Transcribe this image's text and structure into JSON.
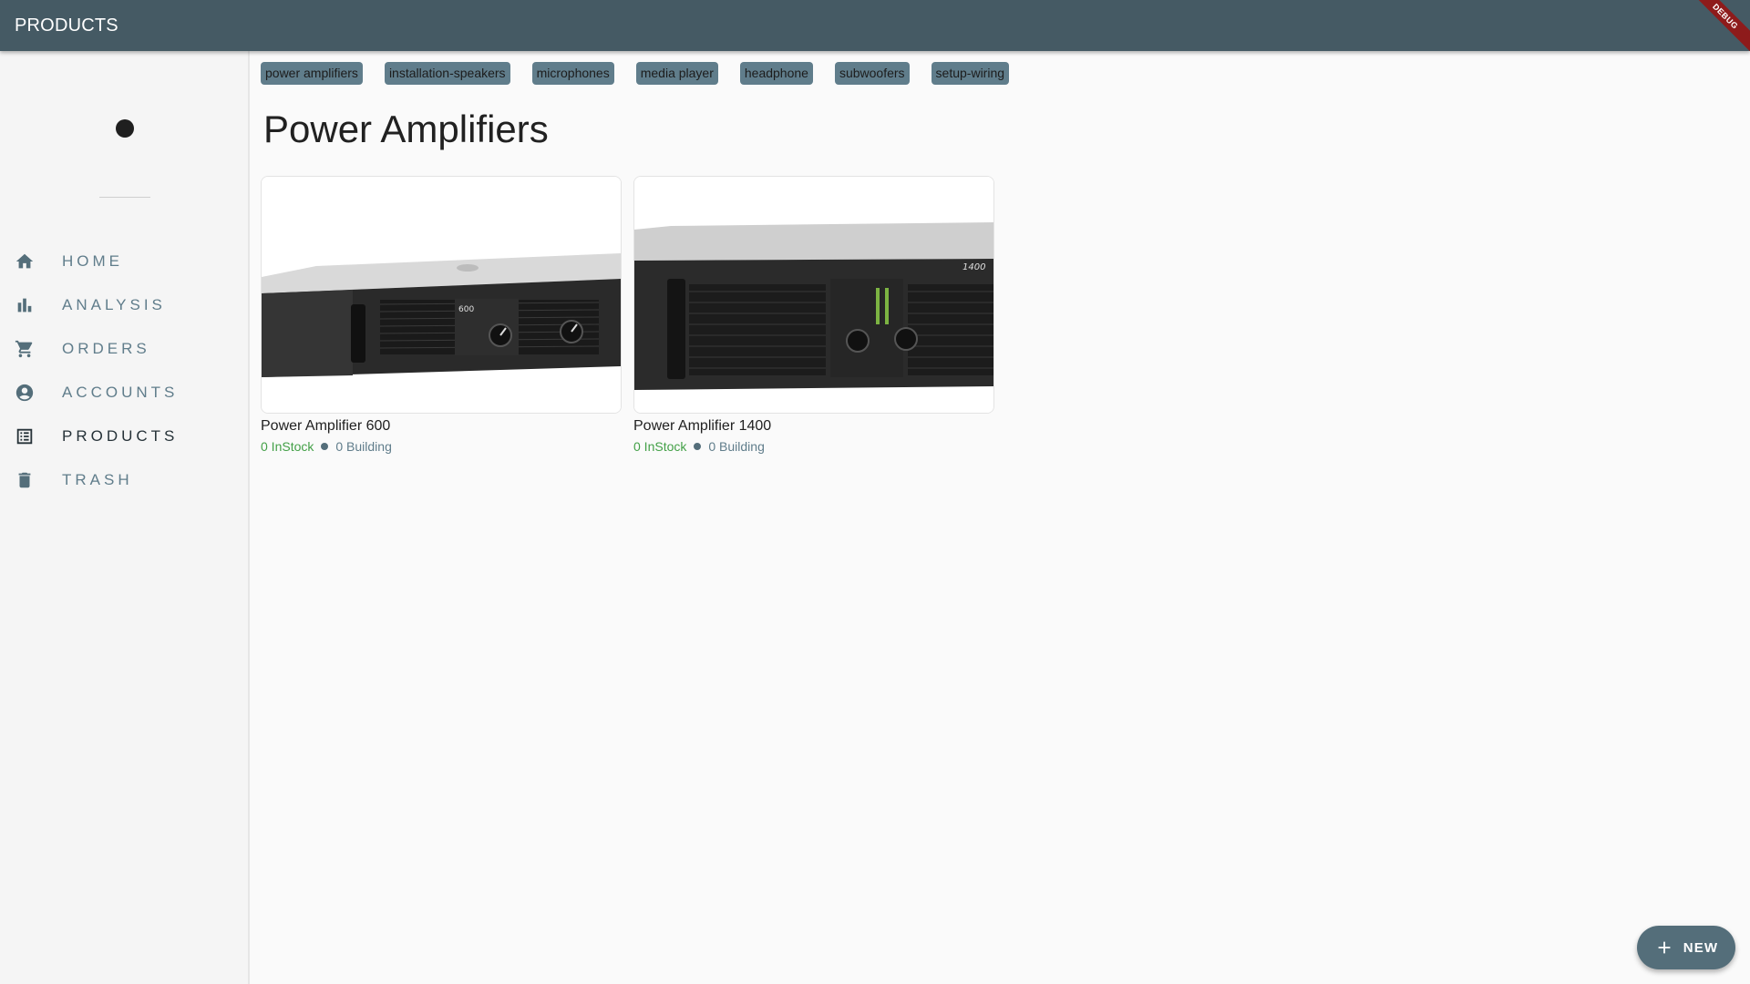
{
  "appbar": {
    "title": "PRODUCTS",
    "debug_banner": "DEBUG"
  },
  "sidebar": {
    "items": [
      {
        "label": "HOME",
        "icon": "home-icon"
      },
      {
        "label": "ANALYSIS",
        "icon": "bar-chart-icon"
      },
      {
        "label": "ORDERS",
        "icon": "cart-icon"
      },
      {
        "label": "ACCOUNTS",
        "icon": "account-circle-icon"
      },
      {
        "label": "PRODUCTS",
        "icon": "list-icon",
        "active": true
      },
      {
        "label": "TRASH",
        "icon": "trash-icon"
      }
    ]
  },
  "categories": [
    "power amplifiers",
    "installation-speakers",
    "microphones",
    "media player",
    "headphone",
    "subwoofers",
    "setup-wiring"
  ],
  "main": {
    "title": "Power Amplifiers"
  },
  "products": [
    {
      "name": "Power Amplifier 600",
      "instock": "0 InStock",
      "building": "0 Building",
      "model_text": "600"
    },
    {
      "name": "Power Amplifier 1400",
      "instock": "0 InStock",
      "building": "0 Building",
      "model_text": "1400"
    }
  ],
  "fab": {
    "label": "NEW",
    "icon": "plus-icon"
  },
  "colors": {
    "appbar": "#455a64",
    "chip": "#607d8b",
    "instock": "#43a047",
    "fab": "#546e7a"
  }
}
